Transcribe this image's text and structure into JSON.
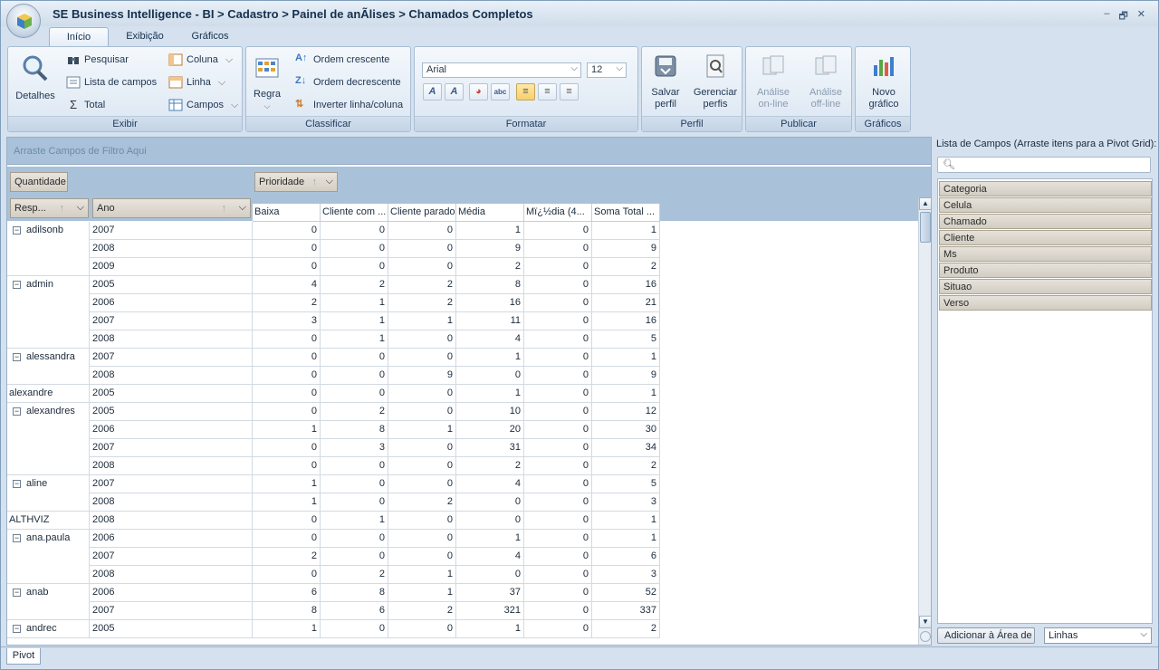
{
  "window": {
    "title": "SE Business Intelligence - BI > Cadastro > Painel de anÃlises > Chamados Completos",
    "controls": [
      "‒",
      "🗗",
      "✕"
    ]
  },
  "tabs": [
    {
      "label": "Início",
      "active": true
    },
    {
      "label": "Exibição",
      "active": false
    },
    {
      "label": "Gráficos",
      "active": false
    }
  ],
  "ribbon": {
    "exibir": {
      "label": "Exibir",
      "detalhes": "Detalhes",
      "pesquisar": "Pesquisar",
      "lista_campos": "Lista de campos",
      "total": "Total",
      "coluna": "Coluna",
      "linha": "Linha",
      "campos": "Campos"
    },
    "classificar": {
      "label": "Classificar",
      "regra": "Regra",
      "ordem_crescente": "Ordem crescente",
      "ordem_decrescente": "Ordem decrescente",
      "inverter": "Inverter linha/coluna"
    },
    "formatar": {
      "label": "Formatar",
      "font": "Arial",
      "size": "12"
    },
    "perfil": {
      "label": "Perfil",
      "salvar_l1": "Salvar",
      "salvar_l2": "perfil",
      "gerenciar_l1": "Gerenciar",
      "gerenciar_l2": "perfis"
    },
    "publicar": {
      "label": "Publicar",
      "online_l1": "Análise",
      "online_l2": "on-line",
      "offline_l1": "Análise",
      "offline_l2": "off-line"
    },
    "graficos": {
      "label": "Gráficos",
      "novo_l1": "Novo",
      "novo_l2": "gráfico"
    }
  },
  "pivot": {
    "filter_placeholder": "Arraste Campos de Filtro Aqui",
    "data_field": "Quantidade",
    "column_field": "Prioridade",
    "row_fields": [
      "Resp...",
      "Ano"
    ],
    "columns": [
      "Baixa",
      "Cliente com ...",
      "Cliente parado",
      "Média",
      "Mï¿½dia  (4...",
      "Soma Total ..."
    ],
    "rows": [
      {
        "resp": "adilsonb",
        "group": true,
        "year": "2007",
        "values": [
          0,
          0,
          0,
          1,
          0,
          1
        ]
      },
      {
        "resp": "",
        "year": "2008",
        "values": [
          0,
          0,
          0,
          9,
          0,
          9
        ]
      },
      {
        "resp": "",
        "year": "2009",
        "values": [
          0,
          0,
          0,
          2,
          0,
          2
        ]
      },
      {
        "resp": "admin",
        "group": true,
        "year": "2005",
        "values": [
          4,
          2,
          2,
          8,
          0,
          16
        ]
      },
      {
        "resp": "",
        "year": "2006",
        "values": [
          2,
          1,
          2,
          16,
          0,
          21
        ]
      },
      {
        "resp": "",
        "year": "2007",
        "values": [
          3,
          1,
          1,
          11,
          0,
          16
        ]
      },
      {
        "resp": "",
        "year": "2008",
        "values": [
          0,
          1,
          0,
          4,
          0,
          5
        ]
      },
      {
        "resp": "alessandra",
        "group": true,
        "year": "2007",
        "values": [
          0,
          0,
          0,
          1,
          0,
          1
        ]
      },
      {
        "resp": "",
        "year": "2008",
        "values": [
          0,
          0,
          9,
          0,
          0,
          9
        ]
      },
      {
        "resp": "alexandre",
        "group": false,
        "year": "2005",
        "values": [
          0,
          0,
          0,
          1,
          0,
          1
        ]
      },
      {
        "resp": "alexandres",
        "group": true,
        "year": "2005",
        "values": [
          0,
          2,
          0,
          10,
          0,
          12
        ]
      },
      {
        "resp": "",
        "year": "2006",
        "values": [
          1,
          8,
          1,
          20,
          0,
          30
        ]
      },
      {
        "resp": "",
        "year": "2007",
        "values": [
          0,
          3,
          0,
          31,
          0,
          34
        ]
      },
      {
        "resp": "",
        "year": "2008",
        "values": [
          0,
          0,
          0,
          2,
          0,
          2
        ]
      },
      {
        "resp": "aline",
        "group": true,
        "year": "2007",
        "values": [
          1,
          0,
          0,
          4,
          0,
          5
        ]
      },
      {
        "resp": "",
        "year": "2008",
        "values": [
          1,
          0,
          2,
          0,
          0,
          3
        ]
      },
      {
        "resp": "ALTHVIZ",
        "group": false,
        "year": "2008",
        "values": [
          0,
          1,
          0,
          0,
          0,
          1
        ]
      },
      {
        "resp": "ana.paula",
        "group": true,
        "year": "2006",
        "values": [
          0,
          0,
          0,
          1,
          0,
          1
        ]
      },
      {
        "resp": "",
        "year": "2007",
        "values": [
          2,
          0,
          0,
          4,
          0,
          6
        ]
      },
      {
        "resp": "",
        "year": "2008",
        "values": [
          0,
          2,
          1,
          0,
          0,
          3
        ]
      },
      {
        "resp": "anab",
        "group": true,
        "year": "2006",
        "values": [
          6,
          8,
          1,
          37,
          0,
          52
        ]
      },
      {
        "resp": "",
        "year": "2007",
        "values": [
          8,
          6,
          2,
          321,
          0,
          337
        ]
      },
      {
        "resp": "andrec",
        "group": true,
        "year": "2005",
        "values": [
          1,
          0,
          0,
          1,
          0,
          2
        ]
      }
    ]
  },
  "fieldlist": {
    "title": "Lista de Campos (Arraste itens para a Pivot Grid):",
    "search_placeholder": "",
    "items": [
      "Categoria",
      "Celula",
      "Chamado",
      "Cliente",
      "Ms",
      "Produto",
      "Situao",
      "Verso"
    ],
    "add_button": "Adicionar à Área de",
    "area_select": "Linhas"
  },
  "status": {
    "sheet_tab": "Pivot"
  }
}
